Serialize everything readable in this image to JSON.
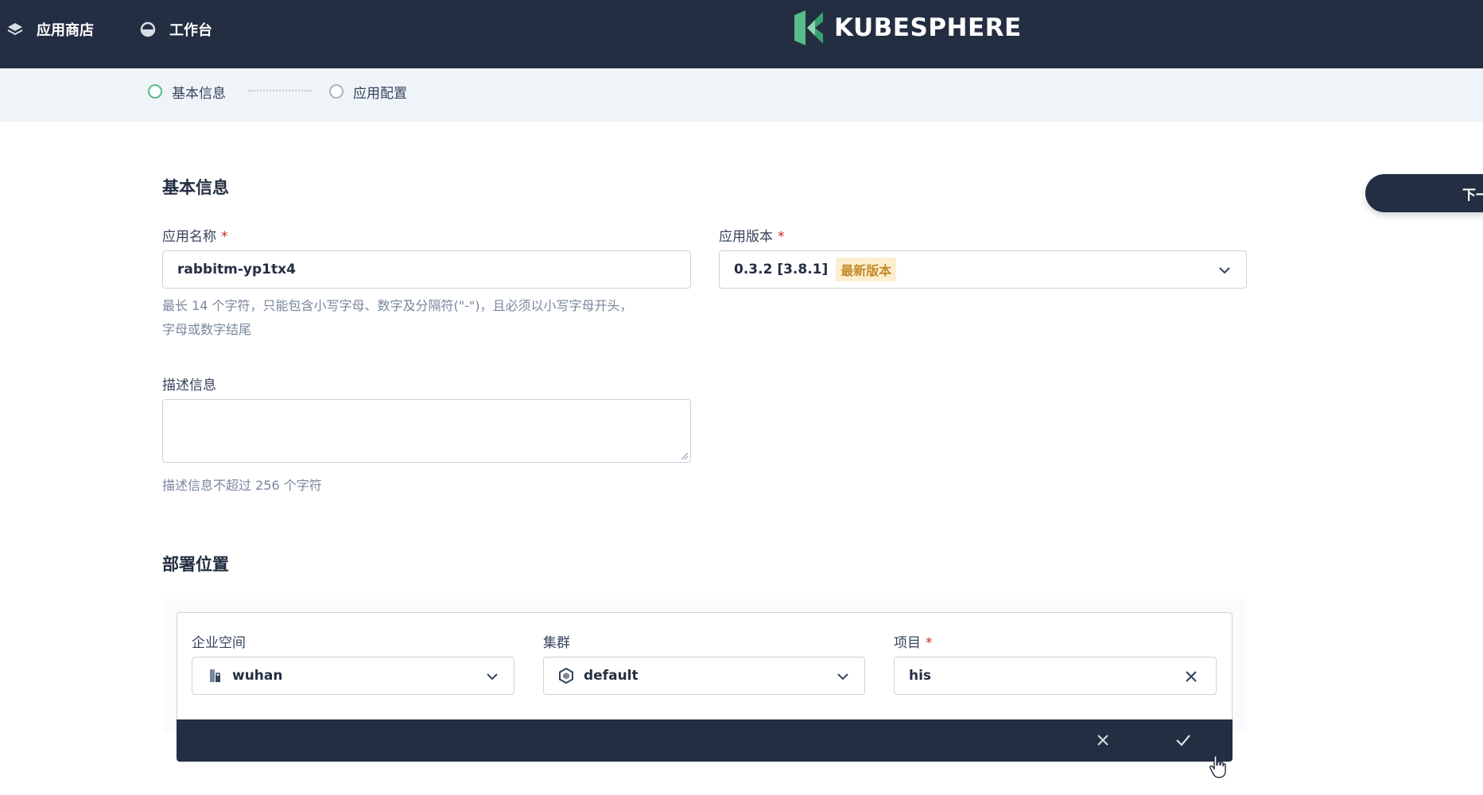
{
  "topbar": {
    "nav": [
      {
        "label": "应用商店",
        "icon": "app-store-icon"
      },
      {
        "label": "工作台",
        "icon": "workbench-icon"
      }
    ],
    "logo_text": "KUBESPHERE"
  },
  "steps": [
    {
      "label": "基本信息",
      "state": "active"
    },
    {
      "label": "应用配置",
      "state": "pending"
    }
  ],
  "basic_info": {
    "title": "基本信息",
    "app_name": {
      "label": "应用名称",
      "required": "*",
      "value": "rabbitm-yp1tx4",
      "hint_line1": "最长 14 个字符，只能包含小写字母、数字及分隔符(\"-\")，且必须以小写字母开头，",
      "hint_line2": "字母或数字结尾"
    },
    "app_version": {
      "label": "应用版本",
      "required": "*",
      "value": "0.3.2 [3.8.1]",
      "tag": "最新版本"
    },
    "description": {
      "label": "描述信息",
      "value": "",
      "hint": "描述信息不超过 256 个字符"
    }
  },
  "deploy": {
    "title": "部署位置",
    "workspace": {
      "label": "企业空间",
      "value": "wuhan",
      "icon": "workspace-icon"
    },
    "cluster": {
      "label": "集群",
      "value": "default",
      "icon": "cluster-icon"
    },
    "project": {
      "label": "项目",
      "required": "*",
      "value": "his"
    }
  },
  "next_button": {
    "label": "下一"
  },
  "colors": {
    "topbar": "#242e42",
    "accent_green": "#55bc8a",
    "required_red": "#ca2621",
    "tag_bg": "#fcefcf"
  }
}
